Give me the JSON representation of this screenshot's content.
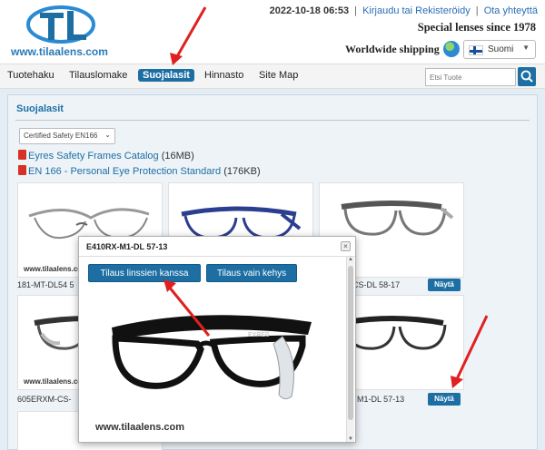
{
  "header": {
    "logo_url": "www.tilaalens.com",
    "datetime": "2022-10-18 06:53",
    "login_link": "Kirjaudu tai Rekisteröidy",
    "contact_link": "Ota yhteyttä",
    "tagline": "Special lenses since 1978",
    "shipping": "Worldwide shipping",
    "language": "Suomi"
  },
  "nav": {
    "items": [
      "Tuotehaku",
      "Tilauslomake",
      "Suojalasit",
      "Hinnasto",
      "Site Map"
    ],
    "active": "Suojalasit",
    "search_placeholder": "Etsi Tuote"
  },
  "main": {
    "title": "Suojalasit",
    "filter_value": "Certified Safety EN166",
    "docs": [
      {
        "label": "Eyres Safety Frames Catalog",
        "size": "(16MB)"
      },
      {
        "label": "EN 166 - Personal Eye Protection Standard",
        "size": "(176KB)"
      }
    ],
    "cards": [
      {
        "label": "181-MT-DL54 5"
      },
      {
        "label": ""
      },
      {
        "label": "-CS-DL 58-17"
      },
      {
        "label": "605ERXM-CS-"
      },
      {
        "label": ""
      },
      {
        "label": "M1-DL 57-13"
      }
    ],
    "card_brand": "www.tilaalens.com",
    "show_button": "Näytä"
  },
  "modal": {
    "title": "E410RX-M1-DL 57-13",
    "close": "×",
    "order_with_lenses": "Tilaus linssien kanssa",
    "order_frame_only": "Tilaus vain kehys",
    "brand": "www.tilaalens.com",
    "product_brand": "EYRES"
  },
  "colors": {
    "accent": "#1d6fa3",
    "arrow": "#e02020",
    "link": "#2a6db5"
  }
}
